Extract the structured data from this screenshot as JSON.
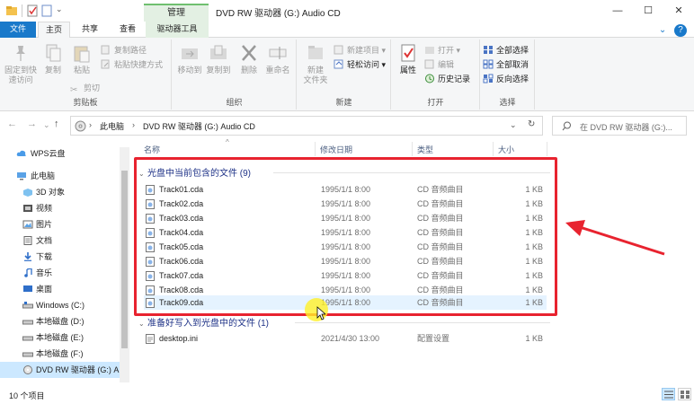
{
  "window": {
    "title": "DVD RW 驱动器 (G:) Audio CD",
    "context_tab": "管理",
    "minimize": "—",
    "maximize": "☐",
    "close": "✕"
  },
  "menu": {
    "file": "文件",
    "home": "主页",
    "share": "共享",
    "view": "查看",
    "drive_tools": "驱动器工具",
    "expand": "⌄",
    "help": "?"
  },
  "ribbon": {
    "clipboard": {
      "group": "剪贴板",
      "pin": "固定到快速访问",
      "pin_line1": "固定到快",
      "pin_line2": "速访问",
      "copy": "复制",
      "paste": "粘贴",
      "copy_path": "复制路径",
      "paste_shortcut": "粘贴快捷方式",
      "cut": "剪切"
    },
    "organize": {
      "group": "组织",
      "move_to": "移动到",
      "copy_to": "复制到",
      "delete": "删除",
      "rename": "重命名"
    },
    "new": {
      "group": "新建",
      "new_folder_line1": "新建",
      "new_folder_line2": "文件夹",
      "new_item": "新建项目",
      "easy_access": "轻松访问"
    },
    "open": {
      "group": "打开",
      "properties": "属性",
      "open": "打开",
      "edit": "编辑",
      "history": "历史记录"
    },
    "select": {
      "group": "选择",
      "select_all": "全部选择",
      "select_none": "全部取消",
      "invert": "反向选择"
    }
  },
  "address": {
    "crumbs": [
      "此电脑",
      "DVD RW 驱动器 (G:) Audio CD"
    ],
    "search_placeholder": "在 DVD RW 驱动器 (G:)...",
    "back": "←",
    "forward": "→",
    "recent": "⌄",
    "up": "↑",
    "dropdown": "⌄",
    "refresh": "↻",
    "separator": "›"
  },
  "nav_pane": {
    "items": [
      {
        "label": "WPS云盘",
        "icon": "cloud-icon"
      },
      {
        "label": "此电脑",
        "icon": "computer-icon"
      },
      {
        "label": "3D 对象",
        "icon": "3d-objects-icon"
      },
      {
        "label": "视频",
        "icon": "video-icon"
      },
      {
        "label": "图片",
        "icon": "pictures-icon"
      },
      {
        "label": "文档",
        "icon": "documents-icon"
      },
      {
        "label": "下载",
        "icon": "download-icon"
      },
      {
        "label": "音乐",
        "icon": "music-icon"
      },
      {
        "label": "桌面",
        "icon": "desktop-icon"
      },
      {
        "label": "Windows (C:)",
        "icon": "drive-icon"
      },
      {
        "label": "本地磁盘 (D:)",
        "icon": "drive-icon"
      },
      {
        "label": "本地磁盘 (E:)",
        "icon": "drive-icon"
      },
      {
        "label": "本地磁盘 (F:)",
        "icon": "drive-icon"
      },
      {
        "label": "DVD RW 驱动器 (G:) A",
        "icon": "dvd-drive-icon"
      }
    ]
  },
  "columns": {
    "name": "名称",
    "modified": "修改日期",
    "type": "类型",
    "size": "大小"
  },
  "groups": [
    {
      "title": "光盘中当前包含的文件 (9)",
      "files": [
        {
          "name": "Track01.cda",
          "modified": "1995/1/1 8:00",
          "type": "CD 音频曲目",
          "size": "1 KB"
        },
        {
          "name": "Track02.cda",
          "modified": "1995/1/1 8:00",
          "type": "CD 音频曲目",
          "size": "1 KB"
        },
        {
          "name": "Track03.cda",
          "modified": "1995/1/1 8:00",
          "type": "CD 音频曲目",
          "size": "1 KB"
        },
        {
          "name": "Track04.cda",
          "modified": "1995/1/1 8:00",
          "type": "CD 音频曲目",
          "size": "1 KB"
        },
        {
          "name": "Track05.cda",
          "modified": "1995/1/1 8:00",
          "type": "CD 音频曲目",
          "size": "1 KB"
        },
        {
          "name": "Track06.cda",
          "modified": "1995/1/1 8:00",
          "type": "CD 音频曲目",
          "size": "1 KB"
        },
        {
          "name": "Track07.cda",
          "modified": "1995/1/1 8:00",
          "type": "CD 音频曲目",
          "size": "1 KB"
        },
        {
          "name": "Track08.cda",
          "modified": "1995/1/1 8:00",
          "type": "CD 音频曲目",
          "size": "1 KB"
        },
        {
          "name": "Track09.cda",
          "modified": "1995/1/1 8:00",
          "type": "CD 音频曲目",
          "size": "1 KB"
        }
      ]
    },
    {
      "title": "准备好写入到光盘中的文件 (1)",
      "files": [
        {
          "name": "desktop.ini",
          "modified": "2021/4/30 13:00",
          "type": "配置设置",
          "size": "1 KB"
        }
      ]
    }
  ],
  "status": {
    "item_count": "10 个项目"
  },
  "colors": {
    "file_tab": "#1979ca",
    "manage_tab": "#e3f0e3",
    "highlight_box": "#e8232f",
    "arrow": "#e8232f",
    "group_header": "#1e3287",
    "selection": "#cce8ff"
  }
}
